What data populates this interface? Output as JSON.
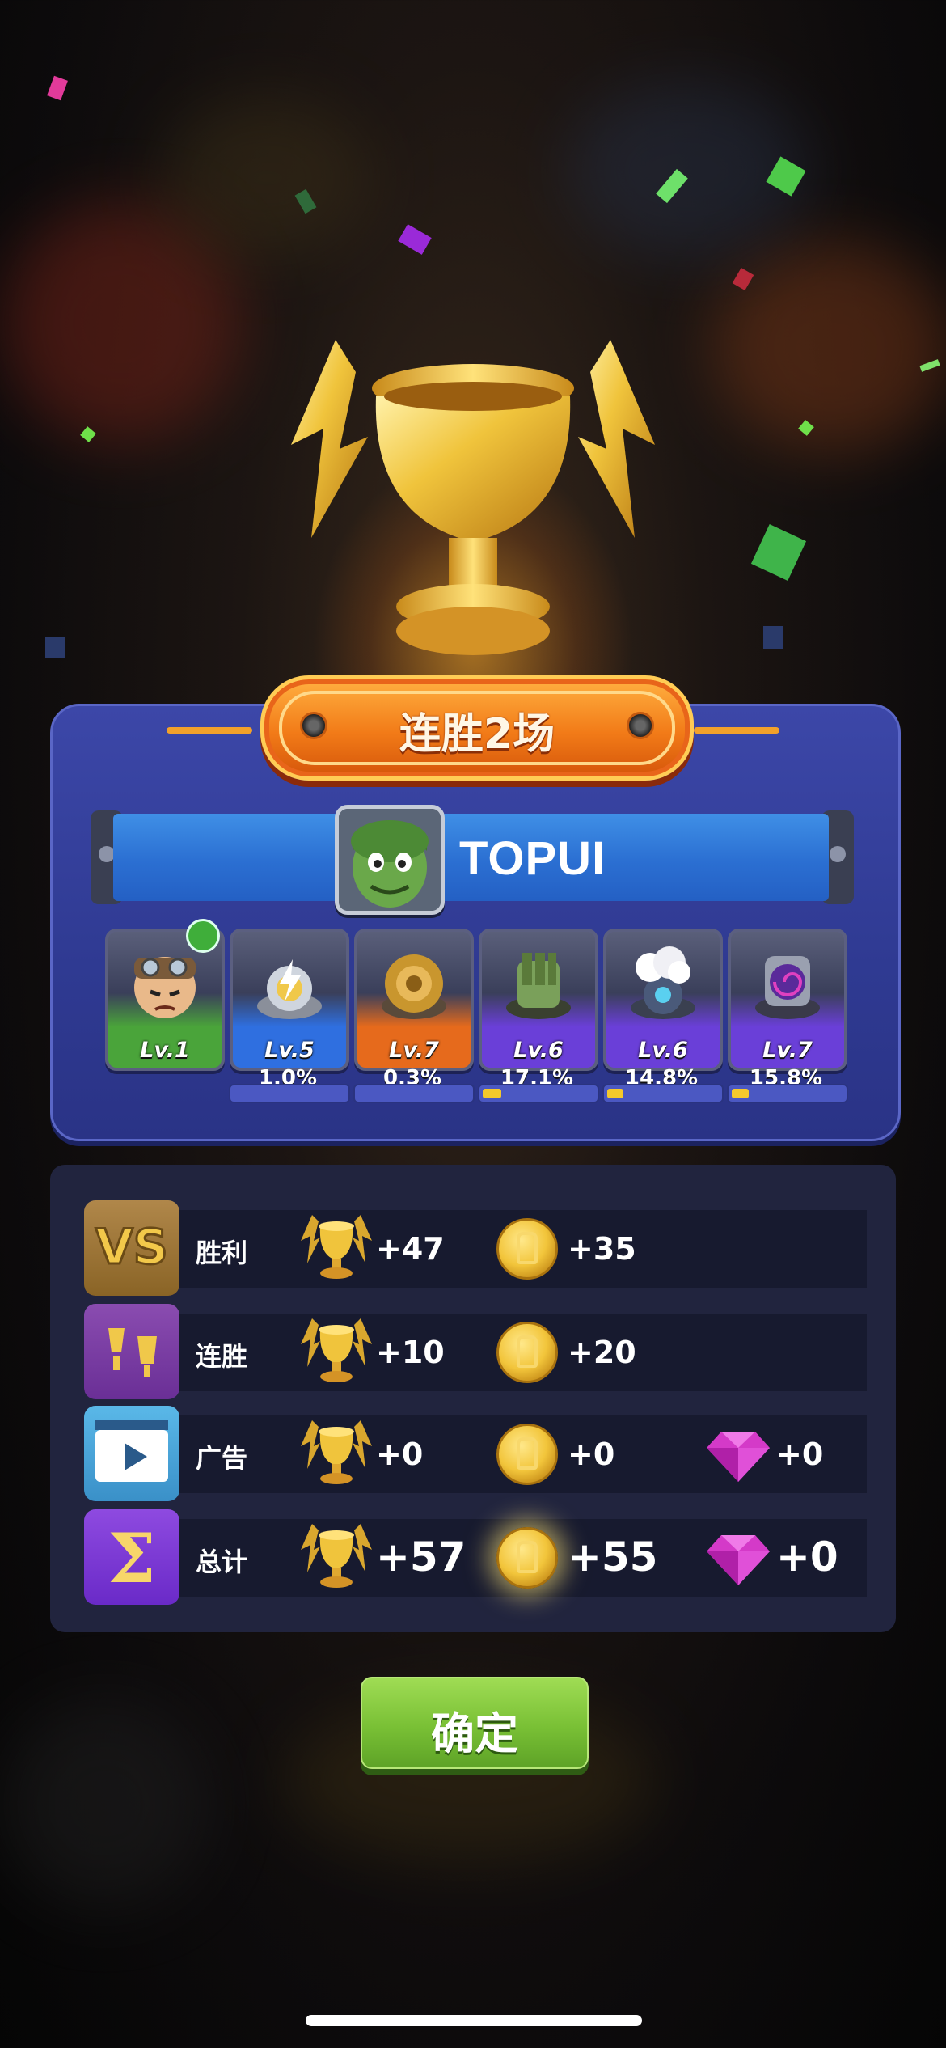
{
  "banner": {
    "title": "连胜2场"
  },
  "player": {
    "name": "TOPUI",
    "avatar_icon": "green-goblin-avatar"
  },
  "units": [
    {
      "level": "Lv.1",
      "percent": "",
      "bar": 0,
      "color": "#4aa43a",
      "icon": "pilot-hero-icon"
    },
    {
      "level": "Lv.5",
      "percent": "1.0%",
      "bar": 0.0,
      "color": "#2f6fe0",
      "icon": "lightning-tower-icon"
    },
    {
      "level": "Lv.7",
      "percent": "0.3%",
      "bar": 0.0,
      "color": "#e66a1c",
      "icon": "gear-tower-icon"
    },
    {
      "level": "Lv.6",
      "percent": "17.1%",
      "bar": 0.171,
      "color": "#6a3fd8",
      "icon": "gatling-tower-icon"
    },
    {
      "level": "Lv.6",
      "percent": "14.8%",
      "bar": 0.148,
      "color": "#6a3fd8",
      "icon": "cloud-tower-icon"
    },
    {
      "level": "Lv.7",
      "percent": "15.8%",
      "bar": 0.158,
      "color": "#6a3fd8",
      "icon": "vortex-tower-icon"
    }
  ],
  "rewards": [
    {
      "label": "胜利",
      "icon": "vs-icon",
      "trophies": "+47",
      "coins": "+35",
      "gems": ""
    },
    {
      "label": "连胜",
      "icon": "win-streak-icon",
      "trophies": "+10",
      "coins": "+20",
      "gems": ""
    },
    {
      "label": "广告",
      "icon": "video-ad-icon",
      "trophies": "+0",
      "coins": "+0",
      "gems": "+0"
    },
    {
      "label": "总计",
      "icon": "sigma-total-icon",
      "trophies": "+57",
      "coins": "+55",
      "gems": "+0"
    }
  ],
  "confirm_label": "确定"
}
